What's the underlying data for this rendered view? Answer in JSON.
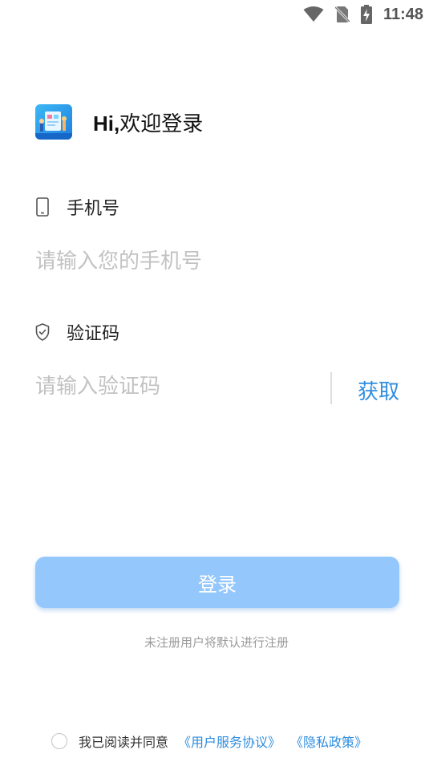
{
  "status_bar": {
    "time": "11:48",
    "icons": [
      "wifi-icon",
      "no-sim-icon",
      "battery-charging-icon"
    ]
  },
  "header": {
    "logo_icon": "app-logo-icon",
    "greeting_hi": "Hi,",
    "greeting_text": "欢迎登录"
  },
  "phone": {
    "icon": "phone-icon",
    "label": "手机号",
    "placeholder": "请输入您的手机号",
    "value": ""
  },
  "code": {
    "icon": "shield-check-icon",
    "label": "验证码",
    "placeholder": "请输入验证码",
    "value": "",
    "get_code_label": "获取"
  },
  "login": {
    "button_label": "登录",
    "hint": "未注册用户将默认进行注册"
  },
  "agreement": {
    "checked": false,
    "text": "我已阅读并同意",
    "terms_link": "《用户服务协议》",
    "privacy_link": "《隐私政策》"
  },
  "colors": {
    "accent": "#2f8ee0",
    "button_bg": "#94c7fc",
    "placeholder": "#c2c2c2"
  }
}
